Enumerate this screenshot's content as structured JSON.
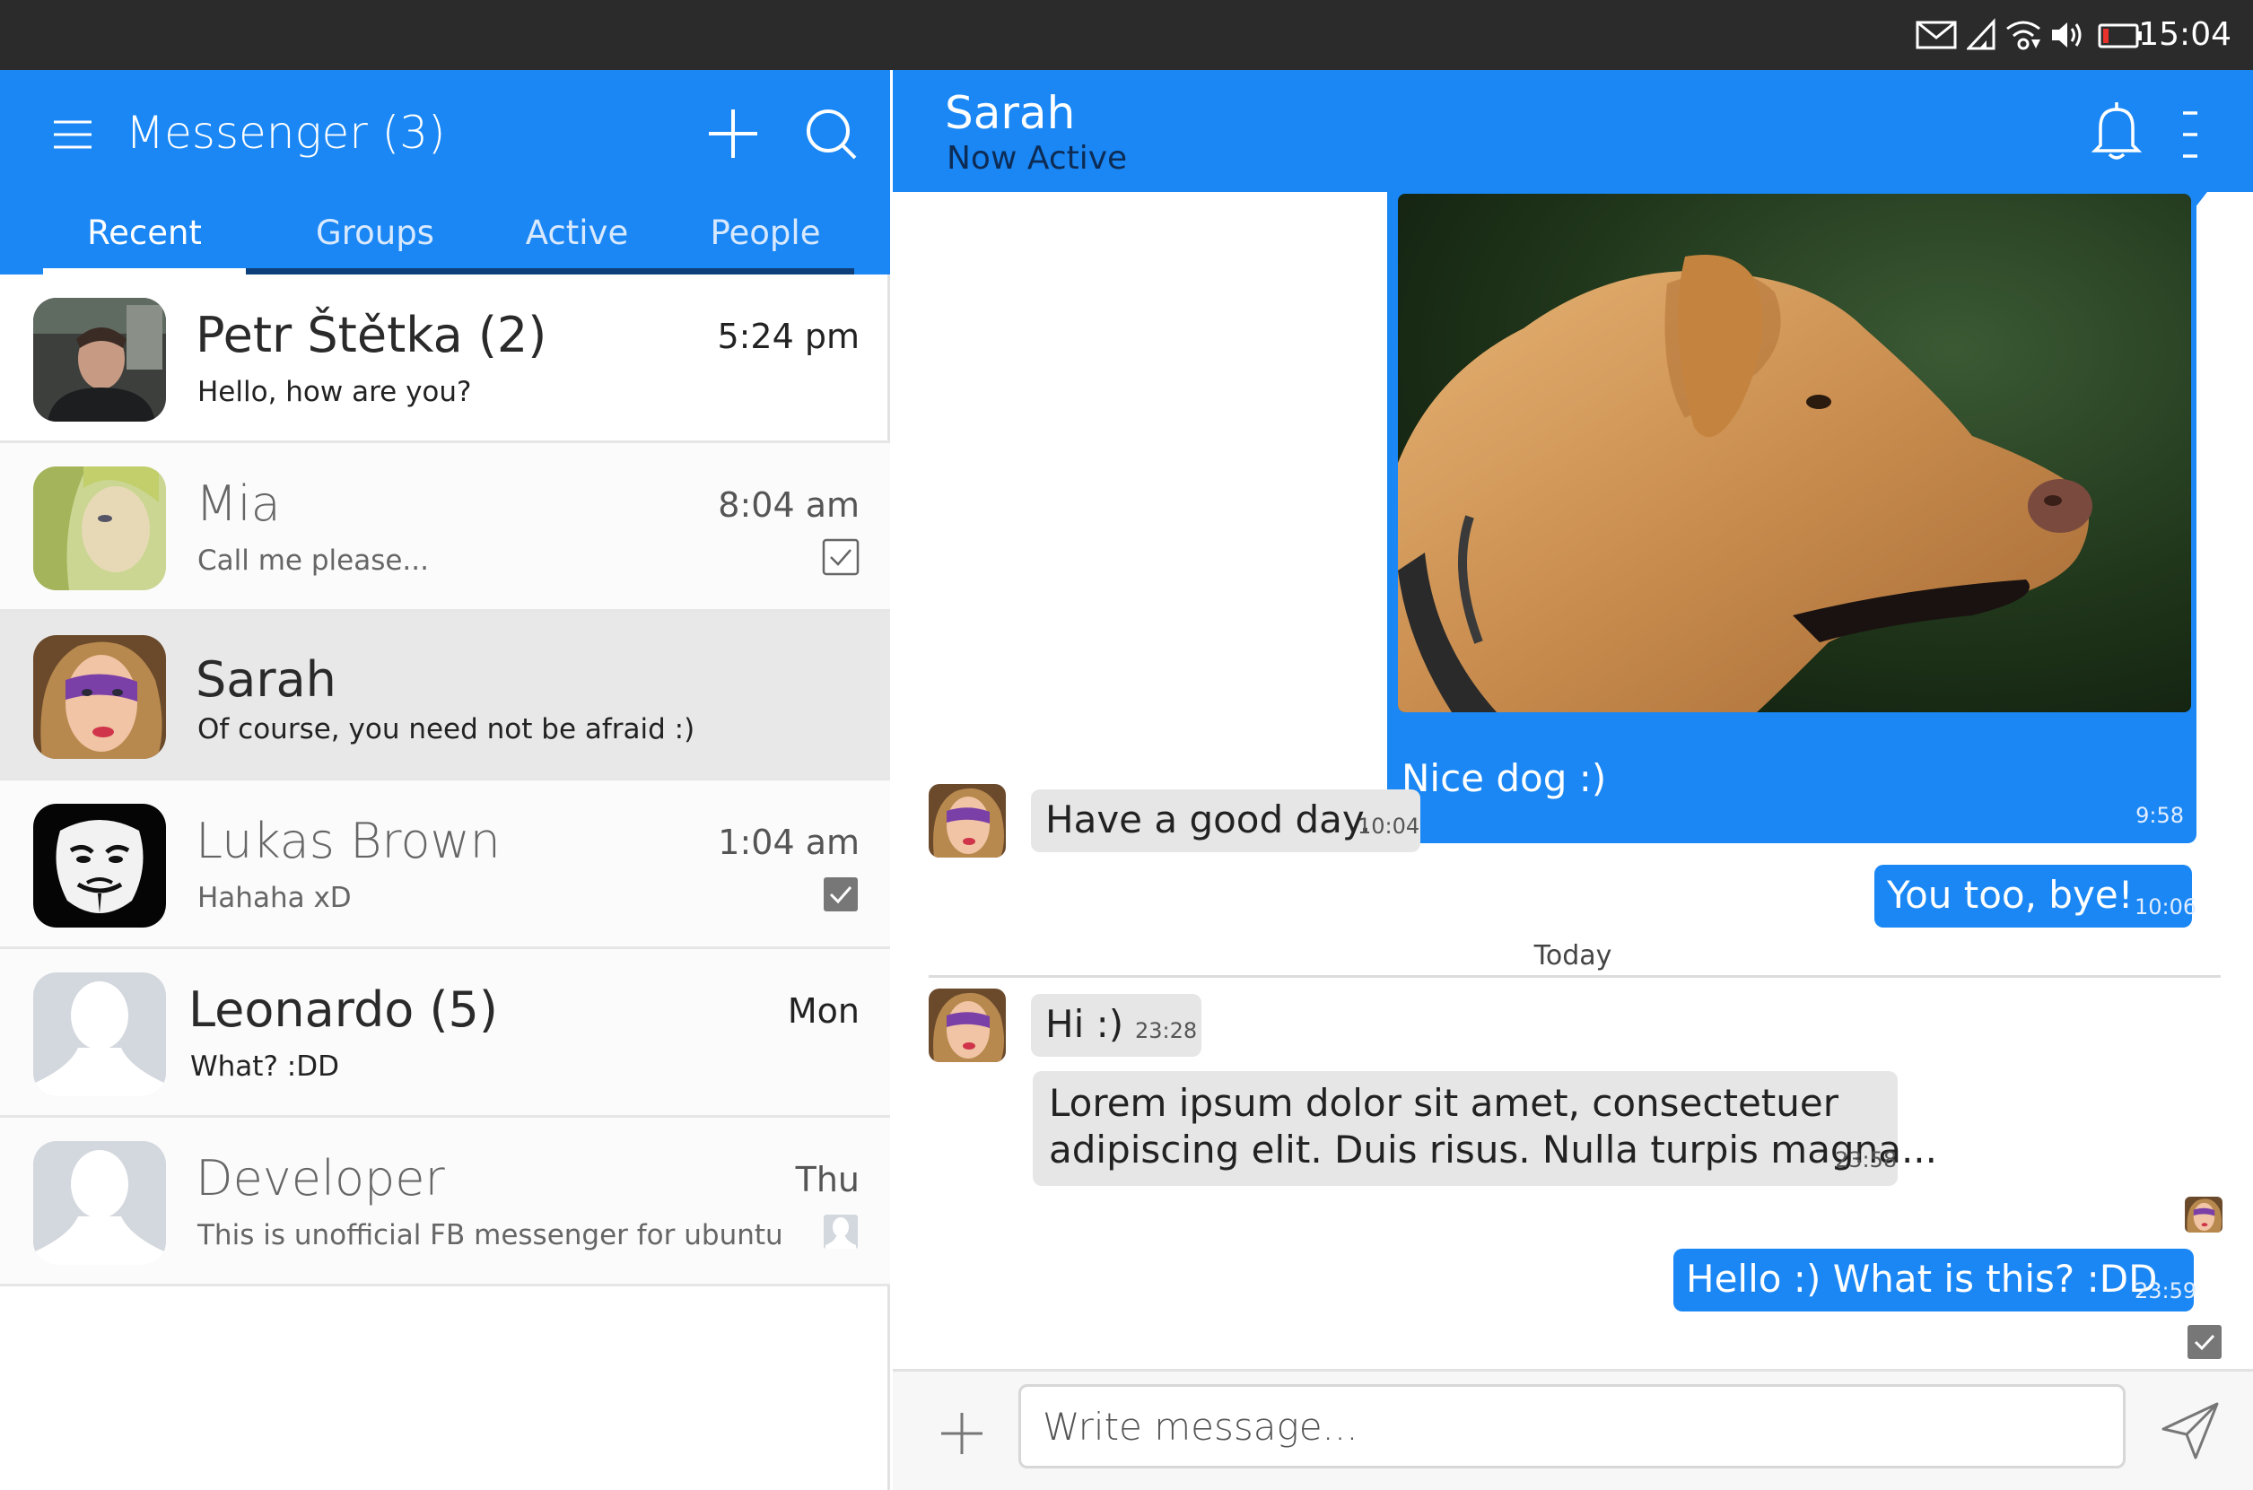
{
  "status_bar": {
    "time": "15:04",
    "icons": [
      "mail-icon",
      "signal-icon",
      "wifi-icon",
      "volume-icon",
      "battery-icon"
    ]
  },
  "app": {
    "title": "Messenger (3)",
    "tabs": [
      {
        "label": "Recent",
        "active": true
      },
      {
        "label": "Groups",
        "active": false
      },
      {
        "label": "Active",
        "active": false
      },
      {
        "label": "People",
        "active": false
      }
    ]
  },
  "conversations": [
    {
      "name": "Petr Štětka (2)",
      "snippet": "Hello, how are you?",
      "time": "5:24 pm",
      "unread": true,
      "status": "none"
    },
    {
      "name": "Mia",
      "snippet": "Call me please...",
      "time": "8:04 am",
      "unread": false,
      "status": "sent-check"
    },
    {
      "name": "Sarah",
      "snippet": "Of course, you need not be afraid :)",
      "time": "",
      "unread": true,
      "status": "none",
      "selected": true
    },
    {
      "name": "Lukas Brown",
      "snippet": "Hahaha xD",
      "time": "1:04 am",
      "unread": false,
      "status": "read-check"
    },
    {
      "name": "Leonardo (5)",
      "snippet": "What? :DD",
      "time": "Mon",
      "unread": true,
      "status": "none"
    },
    {
      "name": "Developer",
      "snippet": "This is unofficial FB messenger for ubuntu",
      "time": "Thu",
      "unread": false,
      "status": "seen-avatar"
    }
  ],
  "chat": {
    "contact_name": "Sarah",
    "contact_status": "Now Active",
    "messages": [
      {
        "direction": "out",
        "type": "image",
        "image": "dog-photo",
        "text": "Nice dog :)",
        "time": "9:58"
      },
      {
        "direction": "in",
        "text": "Have a good day.",
        "time": "10:04"
      },
      {
        "direction": "out",
        "text": "You too, bye!",
        "time": "10:06"
      },
      {
        "direction": "in",
        "text": "Hi :)",
        "time": "23:28"
      },
      {
        "direction": "in",
        "text_lines": [
          "Lorem ipsum dolor sit amet, consectetuer",
          "adipiscing elit. Duis risus. Nulla turpis magna..."
        ],
        "time": "23:58"
      },
      {
        "direction": "out",
        "text": "Hello :) What is this? :DD",
        "time": "23:59"
      }
    ],
    "day_separator": "Today",
    "composer_placeholder": "Write message..."
  },
  "colors": {
    "accent": "#1a87f5",
    "status_bar": "#2b2b2b",
    "selected_row": "#e8e8e8",
    "incoming_bubble": "#e6e6e6"
  }
}
